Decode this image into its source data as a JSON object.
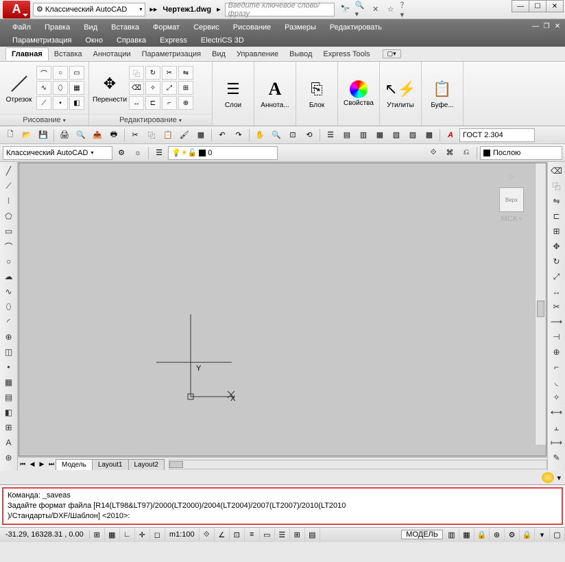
{
  "title": {
    "workspace": "Классический AutoCAD",
    "filename": "Чертеж1.dwg",
    "search_placeholder": "Введите ключевое слово/фразу"
  },
  "menu": {
    "row1": [
      "Файл",
      "Правка",
      "Вид",
      "Вставка",
      "Формат",
      "Сервис",
      "Рисование",
      "Размеры",
      "Редактировать"
    ],
    "row2": [
      "Параметризация",
      "Окно",
      "Справка",
      "Express",
      "ElectriCS 3D"
    ]
  },
  "ribbon_tabs": [
    "Главная",
    "Вставка",
    "Аннотации",
    "Параметризация",
    "Вид",
    "Управление",
    "Вывод",
    "Express Tools"
  ],
  "ribbon": {
    "draw": {
      "big": "Отрезок",
      "title": "Рисование"
    },
    "edit": {
      "big": "Перенести",
      "title": "Редактирование"
    },
    "layers": "Слои",
    "annot": "Аннота...",
    "block": "Блок",
    "props": "Свойства",
    "utils": "Утилиты",
    "buff": "Буфе..."
  },
  "tbar2": {
    "workspace": "Классический AutoCAD",
    "layer": "0",
    "bylayer": "Послою",
    "style": "ГОСТ 2.304"
  },
  "viewcube": {
    "face": "Верх",
    "cs": "МСК"
  },
  "tabs": [
    "Модель",
    "Layout1",
    "Layout2"
  ],
  "command": {
    "line1": "Команда: _saveas",
    "line2": "Задайте формат файла [R14(LT98&LT97)/2000(LT2000)/2004(LT2004)/2007(LT2007)/2010(LT2010",
    "line3": ")/Стандарты/DXF/Шаблон] <2010>:"
  },
  "status": {
    "coords": "-31.29,  16328.31 , 0.00",
    "scale": "m1:100",
    "model": "МОДЕЛЬ"
  }
}
